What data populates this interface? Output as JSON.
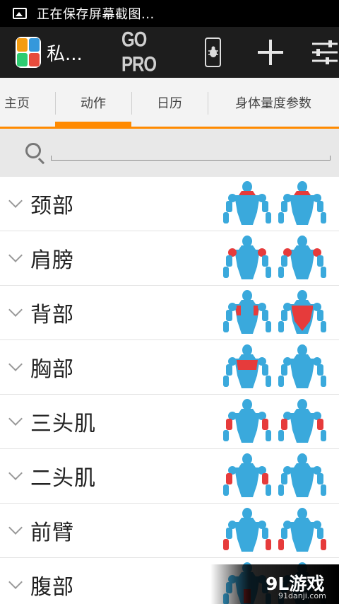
{
  "status_bar": {
    "text": "正在保存屏幕截图..."
  },
  "action_bar": {
    "title": "私...",
    "go_pro": "GO PRO"
  },
  "tabs": [
    {
      "label": "主页",
      "active": false
    },
    {
      "label": "动作",
      "active": true
    },
    {
      "label": "日历",
      "active": false
    },
    {
      "label": "身体量度参数",
      "active": false
    }
  ],
  "search": {
    "value": "",
    "placeholder": ""
  },
  "muscle_groups": [
    {
      "label": "颈部",
      "front": [
        "neck"
      ],
      "back": [
        "upper_trap"
      ]
    },
    {
      "label": "肩膀",
      "front": [
        "shoulders"
      ],
      "back": [
        "shoulders"
      ]
    },
    {
      "label": "背部",
      "front": [
        "lats"
      ],
      "back": [
        "back"
      ]
    },
    {
      "label": "胸部",
      "front": [
        "chest"
      ],
      "back": []
    },
    {
      "label": "三头肌",
      "front": [
        "triceps"
      ],
      "back": [
        "triceps"
      ]
    },
    {
      "label": "二头肌",
      "front": [
        "biceps"
      ],
      "back": [
        "biceps"
      ]
    },
    {
      "label": "前臂",
      "front": [
        "forearms"
      ],
      "back": [
        "forearms"
      ]
    },
    {
      "label": "腹部",
      "front": [
        "abs"
      ],
      "back": []
    }
  ],
  "colors": {
    "accent": "#ff8a00",
    "body": "#3aa9dc",
    "highlight": "#e63b3b",
    "action_bar": "#1d1d1d"
  },
  "watermark": {
    "brand": "9L游戏",
    "domain": "91danji.com"
  }
}
